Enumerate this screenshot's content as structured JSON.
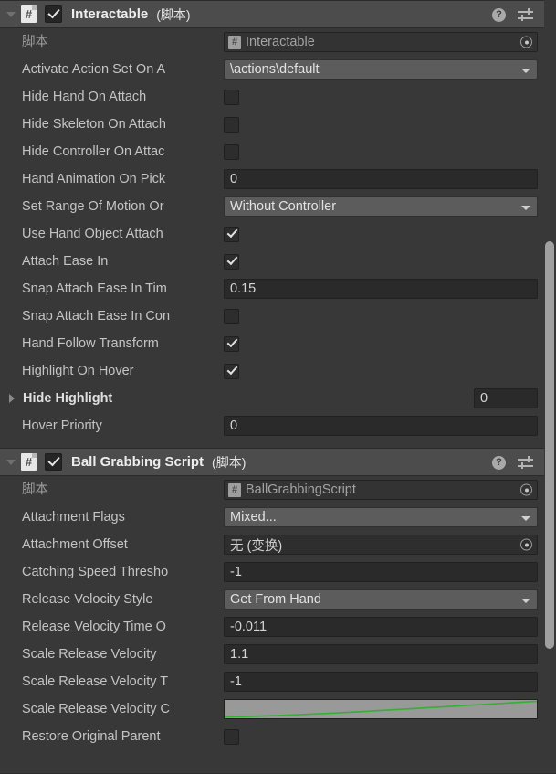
{
  "window": {
    "background": "#383838",
    "header_background": "#4c4c4c",
    "accent_curve": "#35b035"
  },
  "components": [
    {
      "header": {
        "title": "Interactable",
        "subtitle": "(脚本)",
        "enabled_checkbox": true,
        "foldout_open": true,
        "icons": {
          "help": "?",
          "help_icon_name": "help-icon",
          "preset_icon_name": "preset-settings-icon",
          "menu_icon_name": "more-options-icon"
        },
        "badge_glyph": "#"
      },
      "rows": [
        {
          "kind": "object",
          "label": "脚本",
          "label_dim": true,
          "value": "Interactable",
          "badge": "#",
          "disabled": true
        },
        {
          "kind": "dropdown",
          "label": "Activate Action Set On A",
          "value": "\\actions\\default"
        },
        {
          "kind": "checkbox",
          "label": "Hide Hand On Attach",
          "value": false
        },
        {
          "kind": "checkbox",
          "label": "Hide Skeleton On Attach",
          "value": false
        },
        {
          "kind": "checkbox",
          "label": "Hide Controller On Attac",
          "value": false
        },
        {
          "kind": "text",
          "label": "Hand Animation On Pick",
          "value": "0"
        },
        {
          "kind": "dropdown",
          "label": "Set Range Of Motion Or",
          "value": "Without Controller"
        },
        {
          "kind": "checkbox",
          "label": "Use Hand Object Attach",
          "value": true
        },
        {
          "kind": "checkbox",
          "label": "Attach Ease In",
          "value": true
        },
        {
          "kind": "text",
          "label": "Snap Attach Ease In Tim",
          "value": "0.15"
        },
        {
          "kind": "checkbox",
          "label": "Snap Attach Ease In Con",
          "value": false
        },
        {
          "kind": "checkbox",
          "label": "Hand Follow Transform",
          "value": true
        },
        {
          "kind": "checkbox",
          "label": "Highlight On Hover",
          "value": true
        },
        {
          "kind": "array",
          "label": "Hide Highlight",
          "size": "0",
          "expanded": false
        },
        {
          "kind": "text",
          "label": "Hover Priority",
          "value": "0"
        }
      ]
    },
    {
      "header": {
        "title": "Ball Grabbing Script",
        "subtitle": "(脚本)",
        "enabled_checkbox": true,
        "foldout_open": true,
        "icons": {
          "help": "?",
          "help_icon_name": "help-icon",
          "preset_icon_name": "preset-settings-icon",
          "menu_icon_name": "more-options-icon"
        },
        "badge_glyph": "#"
      },
      "rows": [
        {
          "kind": "object",
          "label": "脚本",
          "label_dim": true,
          "value": "BallGrabbingScript",
          "badge": "#",
          "disabled": true
        },
        {
          "kind": "dropdown",
          "label": "Attachment Flags",
          "value": "Mixed..."
        },
        {
          "kind": "objectref",
          "label": "Attachment Offset",
          "value": "无 (变换)"
        },
        {
          "kind": "text",
          "label": "Catching Speed Thresho",
          "value": "-1"
        },
        {
          "kind": "dropdown",
          "label": "Release Velocity Style",
          "value": "Get From Hand"
        },
        {
          "kind": "text",
          "label": "Release Velocity Time O",
          "value": "-0.011"
        },
        {
          "kind": "text",
          "label": "Scale Release Velocity",
          "value": "1.1"
        },
        {
          "kind": "text",
          "label": "Scale Release Velocity T",
          "value": "-1"
        },
        {
          "kind": "curve",
          "label": "Scale Release Velocity C",
          "curve_color": "#35b035"
        },
        {
          "kind": "checkbox",
          "label": "Restore Original Parent",
          "value": false
        }
      ]
    }
  ],
  "scrollbar": {
    "visible": true
  }
}
